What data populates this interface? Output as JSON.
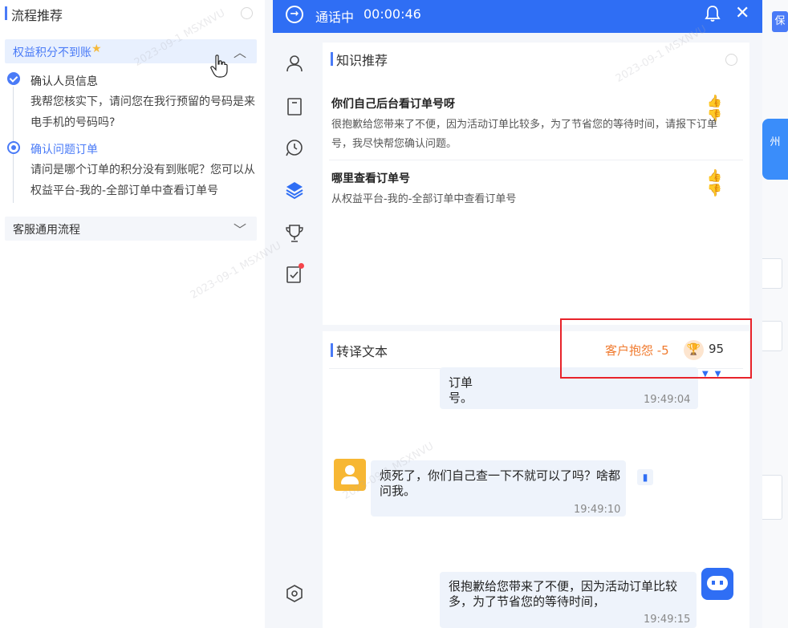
{
  "flow_panel": {
    "title": "流程推荐",
    "group1": {
      "label": "权益积分不到账"
    },
    "steps": [
      {
        "title": "确认人员信息",
        "text": "我帮您核实下，请问您在我行预留的号码是来电手机的号码吗?"
      },
      {
        "title": "确认问题订单",
        "text": "请问是哪个订单的积分没有到账呢？您可以从权益平台-我的-全部订单中查看订单号"
      }
    ],
    "group2": {
      "label": "客服通用流程"
    }
  },
  "call": {
    "status": "通话中",
    "timer": "00:00:46"
  },
  "knowledge": {
    "title": "知识推荐",
    "items": [
      {
        "question": "你们自己后台看订单号呀",
        "answer": "很抱歉给您带来了不便，因为活动订单比较多，为了节省您的等待时间，请报下订单号，我尽快帮您确认问题。"
      },
      {
        "question": "哪里查看订单号",
        "answer": "从权益平台-我的-全部订单中查看订单号"
      }
    ]
  },
  "transcript": {
    "title": "转译文本",
    "complaint": "客户抱怨 -5",
    "score": "95",
    "messages": [
      {
        "text": "订单号。",
        "time": "19:49:04"
      },
      {
        "text": "烦死了，你们自己查一下不就可以了吗？啥都问我。",
        "time": "19:49:10"
      },
      {
        "text": "很抱歉给您带来了不便，因为活动订单比较多，为了节省您的等待时间，",
        "time": "19:49:15"
      }
    ]
  },
  "background": {
    "save_label": "保",
    "side_tab": "州"
  },
  "watermark": "2023-09-1  MSXNVU",
  "colors": {
    "primary": "#2f6ef4",
    "accent_blue": "#4a7bf7",
    "complaint": "#f07a2e",
    "highlight": "#e8232a"
  },
  "icons": {
    "header_back": "arrow-right-circle-icon",
    "bell": "bell-icon",
    "close": "close-icon",
    "rail": [
      "user-icon",
      "bookmark-icon",
      "headset-icon",
      "layers-icon",
      "trophy-icon",
      "checklist-icon",
      "settings-hex-icon"
    ]
  }
}
